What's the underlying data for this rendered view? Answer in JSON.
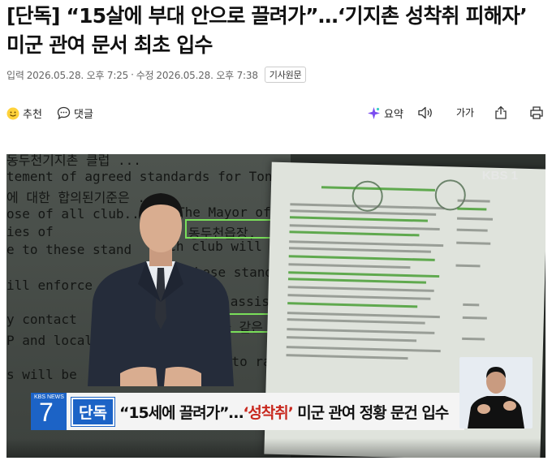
{
  "article": {
    "headline": "[단독] “15살에 부대 안으로 끌려가”…‘기지촌 성착취 피해자’ 미군 관여 문서 최초 입수",
    "published_label": "입력",
    "published_time": "2026.05.28. 오후 7:25",
    "separator": "·",
    "modified_label": "수정",
    "modified_time": "2026.05.28. 오후 7:38",
    "original_button": "기사원문"
  },
  "toolbar": {
    "recommend_label": "추천",
    "comment_label": "댓글",
    "summary_label": "요약",
    "font_size_label": "가가"
  },
  "video": {
    "broadcaster_logo": "KBS 1",
    "news_brand": "KBS NEWS",
    "news_number": "7",
    "tag": "단독",
    "headline_part1": "“15세에 끌려가”…",
    "headline_accent": "‘성착취’",
    "headline_part2": " 미군 관여 정황 문건 입수",
    "paper_lines": [
      "동두천기지촌 클럽 ...",
      "tement of agreed standards for Tongduchon club",
      "에 대한 합의된기준은 ...",
      "ose of all club...",
      "The Mayor of TDC ...",
      "동두천읍장,",
      "ies of",
      "Each club will have a f",
      "e to these stand",
      "these standards.",
      "ill enforce",
      "s for assistance",
      "y contact",
      "미헌병과 같은",
      "P and local",
      "regard to race, creed",
      "s will be"
    ]
  },
  "colors": {
    "accent_blue": "#1c63c6",
    "accent_red": "#c8281e",
    "highlight_green": "#7adf5a"
  }
}
